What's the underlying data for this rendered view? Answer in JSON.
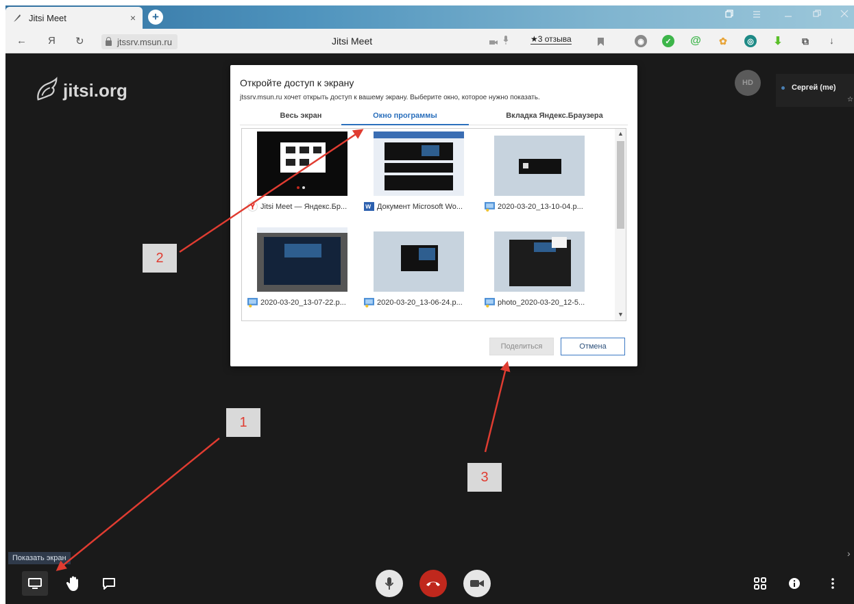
{
  "browser": {
    "tab_title": "Jitsi Meet",
    "tab_close": "×",
    "new_tab": "+",
    "back": "←",
    "yandex_button": "Я",
    "reload": "↻",
    "url": "jtssrv.msun.ru",
    "page_title": "Jitsi Meet",
    "reviews": "★3 отзыва",
    "download": "↓"
  },
  "stage": {
    "logo_text": "jitsi.org",
    "avatar_initials": "HD",
    "participant_name": "Сергей (me)",
    "tooltip": "Показать экран"
  },
  "dialog": {
    "title": "Откройте доступ к экрану",
    "subtitle": "jtssrv.msun.ru хочет открыть доступ к вашему экрану. Выберите окно, которое нужно показать.",
    "tabs": [
      {
        "label": "Весь экран"
      },
      {
        "label": "Окно программы"
      },
      {
        "label": "Вкладка Яндекс.Браузера"
      }
    ],
    "active_tab": "Окно программы",
    "windows": [
      {
        "label": "Jitsi Meet — Яндекс.Бр...",
        "icon": "yandex-browser-icon"
      },
      {
        "label": "Документ Microsoft Wo...",
        "icon": "word-icon"
      },
      {
        "label": "2020-03-20_13-10-04.p...",
        "icon": "image-viewer-icon"
      },
      {
        "label": "2020-03-20_13-07-22.p...",
        "icon": "image-viewer-icon"
      },
      {
        "label": "2020-03-20_13-06-24.p...",
        "icon": "image-viewer-icon"
      },
      {
        "label": "photo_2020-03-20_12-5...",
        "icon": "image-viewer-icon"
      }
    ],
    "share_button": "Поделиться",
    "cancel_button": "Отмена"
  },
  "annotations": [
    {
      "label": "1"
    },
    {
      "label": "2"
    },
    {
      "label": "3"
    }
  ],
  "colors": {
    "stage_bg": "#1a1a1a",
    "accent": "#2a6fbc",
    "hangup": "#c0281d",
    "annotation": "#e03c31"
  }
}
